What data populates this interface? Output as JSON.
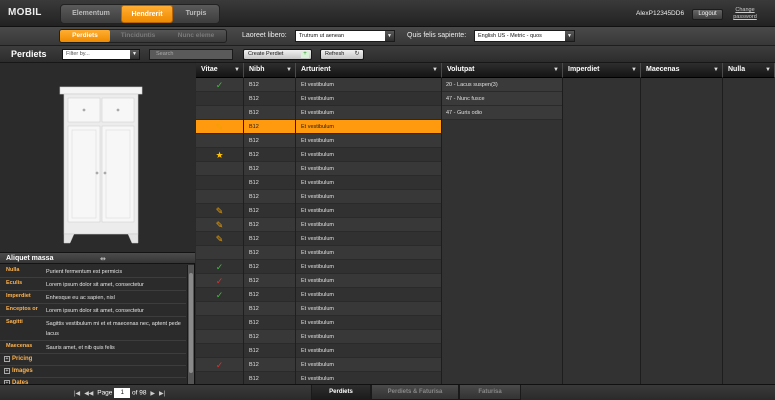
{
  "app": {
    "logo": "MOBIL"
  },
  "nav": {
    "main_tabs": [
      {
        "label": "Elementum",
        "active": false
      },
      {
        "label": "Hendrerit",
        "active": true
      },
      {
        "label": "Turpis",
        "active": false
      }
    ],
    "user": "AlexP12345DD6",
    "logout_label": "Logout",
    "change_password_label": "Change password"
  },
  "subnav": {
    "tabs": [
      {
        "label": "Perdiets",
        "active": true
      },
      {
        "label": "Tinciduntis",
        "active": false
      },
      {
        "label": "Nunc eleme",
        "active": false
      }
    ],
    "laoreet_label": "Laoreet libero:",
    "laoreet_value": "Trutrum ut aenean",
    "quis_label": "Quis felis sapiente:",
    "quis_value": "English US - Metric - quos"
  },
  "toolbar": {
    "title": "Perdiets",
    "filter_placeholder": "Filter by...",
    "search_placeholder": "Search",
    "create_label": "Create Perdiet",
    "refresh_label": "Refresh"
  },
  "details": {
    "section_title": "Aliquet massa",
    "properties": [
      {
        "key": "Nulla",
        "value": "Purient fermentum est permicis"
      },
      {
        "key": "Eculis",
        "value": "Lorem ipsum dolor sit amet, consectetur"
      },
      {
        "key": "Imperdiet",
        "value": "Enhesque eu ac sapien, nisl"
      },
      {
        "key": "Enceptos or",
        "value": "Lorem ipsum dolor sit amet, consectetur"
      },
      {
        "key": "Sagitti",
        "value": "Sagittis vestibulum mi et et maecenas nec, aptent pede lacus"
      },
      {
        "key": "Maecenas",
        "value": "Sauris amet, et nib quis felis"
      }
    ],
    "collapsed_sections": [
      "Pricing",
      "Images",
      "Dates"
    ]
  },
  "grid": {
    "columns": [
      "Vitae",
      "Nibh",
      "Arturient",
      "Volutpat",
      "Imperdiet",
      "Maecenas",
      "Nulla"
    ],
    "rows": [
      {
        "icon": "check-green",
        "nibh": "B12",
        "arturient": "Et vestibulum"
      },
      {
        "icon": "",
        "nibh": "B12",
        "arturient": "Et vestibulum"
      },
      {
        "icon": "",
        "nibh": "B12",
        "arturient": "Et vestibulum"
      },
      {
        "icon": "pencil",
        "nibh": "B12",
        "arturient": "Et vestibulum",
        "selected": true
      },
      {
        "icon": "",
        "nibh": "B12",
        "arturient": "Et vestibulum"
      },
      {
        "icon": "star",
        "nibh": "B12",
        "arturient": "Et vestibulum"
      },
      {
        "icon": "",
        "nibh": "B12",
        "arturient": "Et vestibulum"
      },
      {
        "icon": "",
        "nibh": "B12",
        "arturient": "Et vestibulum"
      },
      {
        "icon": "",
        "nibh": "B12",
        "arturient": "Et vestibulum"
      },
      {
        "icon": "pencil",
        "nibh": "B12",
        "arturient": "Et vestibulum"
      },
      {
        "icon": "pencil",
        "nibh": "B12",
        "arturient": "Et vestibulum"
      },
      {
        "icon": "pencil",
        "nibh": "B12",
        "arturient": "Et vestibulum"
      },
      {
        "icon": "",
        "nibh": "B12",
        "arturient": "Et vestibulum"
      },
      {
        "icon": "check-green",
        "nibh": "B12",
        "arturient": "Et vestibulum"
      },
      {
        "icon": "check-red",
        "nibh": "B12",
        "arturient": "Et vestibulum"
      },
      {
        "icon": "check-green",
        "nibh": "B12",
        "arturient": "Et vestibulum"
      },
      {
        "icon": "",
        "nibh": "B12",
        "arturient": "Et vestibulum"
      },
      {
        "icon": "",
        "nibh": "B12",
        "arturient": "Et vestibulum"
      },
      {
        "icon": "",
        "nibh": "B12",
        "arturient": "Et vestibulum"
      },
      {
        "icon": "",
        "nibh": "B12",
        "arturient": "Et vestibulum"
      },
      {
        "icon": "check-red",
        "nibh": "B12",
        "arturient": "Et vestibulum"
      },
      {
        "icon": "",
        "nibh": "B12",
        "arturient": "Et vestibulum"
      }
    ],
    "volutpat_values": [
      "20 - Lacus suspen(3)",
      "47 - Nunc fusce",
      "47 - Guris odio"
    ]
  },
  "footer": {
    "page_label": "Page",
    "page_current": "1",
    "page_of": "of 98",
    "tabs": [
      {
        "label": "Perdiets",
        "active": true
      },
      {
        "label": "Perdiets & Faturisa",
        "active": false
      },
      {
        "label": "Faturisa",
        "active": false
      }
    ]
  },
  "colors": {
    "accent": "#f39200",
    "check_green": "#3fbf3f",
    "check_red": "#e03030",
    "label_orange": "#ffb24a"
  }
}
